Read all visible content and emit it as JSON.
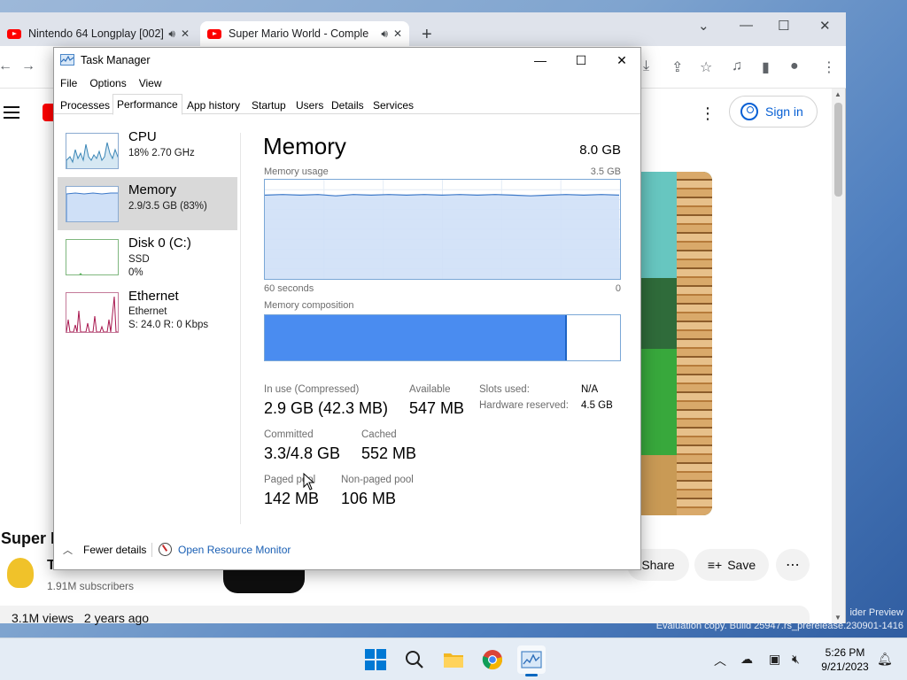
{
  "desktop": {
    "watermark_line1": "ider Preview",
    "watermark_line2": "Evaluation copy. Build 25947.rs_prerelease.230901-1416"
  },
  "browser": {
    "tabs": [
      {
        "title": "Nintendo 64 Longplay [002]"
      },
      {
        "title": "Super Mario World - Comple"
      }
    ],
    "new_tab": "+",
    "signin_label": "Sign in",
    "video_title": "Super M",
    "channel_initial": "T",
    "subscribers": "1.91M subscribers",
    "share_label": "Share",
    "save_label": "Save",
    "views": "3.1M views",
    "age": "2 years ago",
    "accent_color": "#065fd4"
  },
  "taskmanager": {
    "title": "Task Manager",
    "menu": [
      "File",
      "Options",
      "View"
    ],
    "tabs": [
      "Processes",
      "Performance",
      "App history",
      "Startup",
      "Users",
      "Details",
      "Services"
    ],
    "active_tab": "Performance",
    "sidebar": [
      {
        "name": "CPU",
        "line1": "18% 2.70 GHz",
        "line2": ""
      },
      {
        "name": "Memory",
        "line1": "2.9/3.5 GB (83%)",
        "line2": ""
      },
      {
        "name": "Disk 0 (C:)",
        "line1": "SSD",
        "line2": "0%"
      },
      {
        "name": "Ethernet",
        "line1": "Ethernet",
        "line2": "S: 24.0  R: 0 Kbps"
      }
    ],
    "memory": {
      "heading": "Memory",
      "total": "8.0 GB",
      "usage_label": "Memory usage",
      "usage_max": "3.5 GB",
      "time_left": "60 seconds",
      "time_right": "0",
      "usage_fraction": 0.83,
      "composition_label": "Memory composition",
      "composition_in_use_fraction": 0.85,
      "stats": {
        "in_use_label": "In use (Compressed)",
        "in_use_value": "2.9 GB (42.3 MB)",
        "available_label": "Available",
        "available_value": "547 MB",
        "committed_label": "Committed",
        "committed_value": "3.3/4.8 GB",
        "cached_label": "Cached",
        "cached_value": "552 MB",
        "paged_label": "Paged pool",
        "paged_value": "142 MB",
        "nonpaged_label": "Non-paged pool",
        "nonpaged_value": "106 MB",
        "slots_label": "Slots used:",
        "slots_value": "N/A",
        "hw_reserved_label": "Hardware reserved:",
        "hw_reserved_value": "4.5 GB"
      }
    },
    "footer": {
      "fewer_details": "Fewer details",
      "open_resource_monitor": "Open Resource Monitor"
    },
    "colors": {
      "memory_fill": "#cfe0f7",
      "memory_line": "#3c78c8",
      "composition_fill": "#4a8cf0",
      "ethernet_line": "#a8174f",
      "cpu_line": "#3b86b6"
    }
  },
  "taskbar": {
    "time": "5:26 PM",
    "date": "9/21/2023",
    "apps": [
      "windows-start",
      "search",
      "file-explorer",
      "chrome",
      "task-manager"
    ]
  }
}
